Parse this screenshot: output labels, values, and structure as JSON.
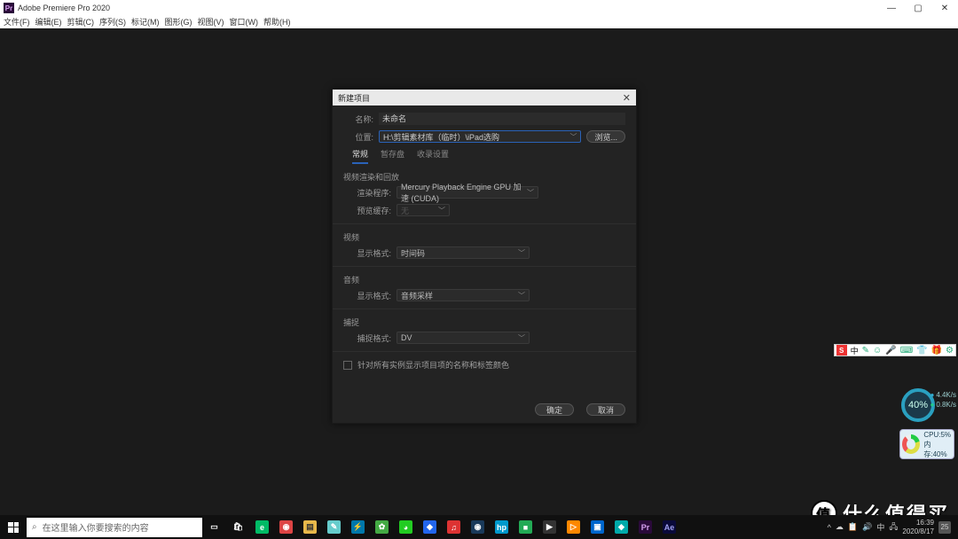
{
  "window": {
    "title": "Adobe Premiere Pro 2020",
    "app_icon_text": "Pr",
    "min": "—",
    "max": "▢",
    "close": "✕"
  },
  "menubar": [
    "文件(F)",
    "编辑(E)",
    "剪辑(C)",
    "序列(S)",
    "标记(M)",
    "图形(G)",
    "视图(V)",
    "窗口(W)",
    "帮助(H)"
  ],
  "dialog": {
    "title": "新建项目",
    "close": "✕",
    "name_label": "名称:",
    "name_value": "未命名",
    "location_label": "位置:",
    "location_value": "H:\\剪辑素材库（临时）\\iPad选购",
    "browse": "浏览...",
    "tabs": [
      "常规",
      "暂存盘",
      "收录设置"
    ],
    "section_render": "视频渲染和回放",
    "renderer_label": "渲染程序:",
    "renderer_value": "Mercury Playback Engine GPU 加速 (CUDA)",
    "preview_cache_label": "预览缓存:",
    "preview_cache_value": "无",
    "section_video": "视频",
    "video_format_label": "显示格式:",
    "video_format_value": "时间码",
    "section_audio": "音频",
    "audio_format_label": "显示格式:",
    "audio_format_value": "音频采样",
    "section_capture": "捕捉",
    "capture_format_label": "捕捉格式:",
    "capture_format_value": "DV",
    "checkbox_label": "针对所有实例显示项目项的名称和标签颜色",
    "ok": "确定",
    "cancel": "取消"
  },
  "ime": {
    "s": "S",
    "zh": "中",
    "items": [
      "✎",
      "☺",
      "🎤",
      "⌨",
      "👕",
      "🎁",
      "⚙"
    ]
  },
  "gauge": {
    "pct": "40%",
    "up": "4.4K/s",
    "down": "0.8K/s"
  },
  "mem": {
    "cpu": "CPU:5%",
    "mem": "内存:40%"
  },
  "watermark": {
    "badge": "值",
    "text": "什么值得买"
  },
  "search": {
    "placeholder": "在这里输入你要搜索的内容",
    "icon": "⌕"
  },
  "taskbar_icons": [
    {
      "name": "task-view",
      "glyph": "▭",
      "bg": "transparent",
      "fg": "#fff"
    },
    {
      "name": "store",
      "glyph": "🛍",
      "bg": "transparent",
      "fg": "#fff"
    },
    {
      "name": "edge",
      "glyph": "e",
      "bg": "#0b6",
      "fg": "#fff"
    },
    {
      "name": "chrome",
      "glyph": "◉",
      "bg": "#d44",
      "fg": "#fff"
    },
    {
      "name": "explorer",
      "glyph": "▤",
      "bg": "#e8b84a",
      "fg": "#333"
    },
    {
      "name": "notepad",
      "glyph": "✎",
      "bg": "#6cc",
      "fg": "#fff"
    },
    {
      "name": "thunder",
      "glyph": "⚡",
      "bg": "#07a",
      "fg": "#fff"
    },
    {
      "name": "app1",
      "glyph": "✿",
      "bg": "#4a4",
      "fg": "#fff"
    },
    {
      "name": "wechat",
      "glyph": "◕",
      "bg": "#2c2",
      "fg": "#fff"
    },
    {
      "name": "tencent",
      "glyph": "◆",
      "bg": "#26e",
      "fg": "#fff"
    },
    {
      "name": "netease",
      "glyph": "♫",
      "bg": "#d33",
      "fg": "#fff"
    },
    {
      "name": "steam",
      "glyph": "◉",
      "bg": "#1a3a5a",
      "fg": "#fff"
    },
    {
      "name": "hp",
      "glyph": "hp",
      "bg": "#09c",
      "fg": "#fff"
    },
    {
      "name": "app2",
      "glyph": "■",
      "bg": "#2a5",
      "fg": "#fff"
    },
    {
      "name": "music",
      "glyph": "▶",
      "bg": "#333",
      "fg": "#fff"
    },
    {
      "name": "video",
      "glyph": "▷",
      "bg": "#f80",
      "fg": "#fff"
    },
    {
      "name": "reader",
      "glyph": "▣",
      "bg": "#06c",
      "fg": "#fff"
    },
    {
      "name": "app3",
      "glyph": "◆",
      "bg": "#0aa",
      "fg": "#fff"
    },
    {
      "name": "premiere",
      "glyph": "Pr",
      "bg": "#2a0a3a",
      "fg": "#d6a0f0"
    },
    {
      "name": "ae",
      "glyph": "Ae",
      "bg": "#0a0a3a",
      "fg": "#a0a0f0"
    }
  ],
  "tray": {
    "icons": [
      "^",
      "☁",
      "📋",
      "🔊",
      "中",
      "🖧"
    ],
    "time": "16:39",
    "date": "2020/8/17",
    "notif": "25"
  }
}
